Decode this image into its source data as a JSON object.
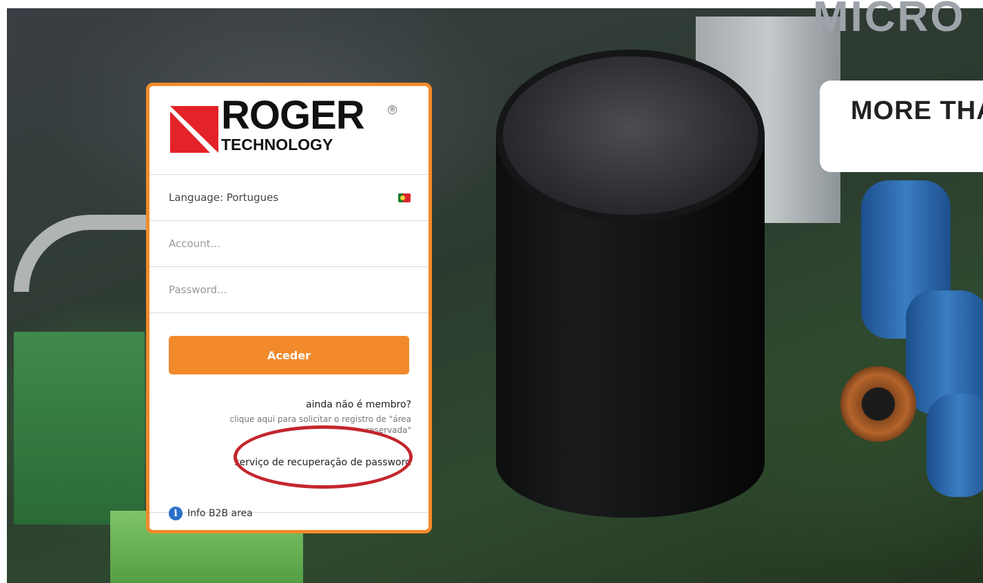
{
  "background": {
    "brand_word": "MICRO",
    "tagline": "MORE THA"
  },
  "logo": {
    "name": "ROGER",
    "sub": "TECHNOLOGY",
    "registered": "®"
  },
  "language": {
    "label": "Language: Portugues"
  },
  "form": {
    "account_placeholder": "Account...",
    "password_placeholder": "Password...",
    "submit_label": "Aceder"
  },
  "links": {
    "member_question": "ainda não é membro?",
    "register_text": "clique aqui para solicitar o registro de \"área reservada\"",
    "recover_password": "serviço de recuperação de password"
  },
  "info": {
    "label": "Info B2B area",
    "icon": "i"
  },
  "colors": {
    "accent": "#f28a2b",
    "highlight": "#c4262d"
  }
}
